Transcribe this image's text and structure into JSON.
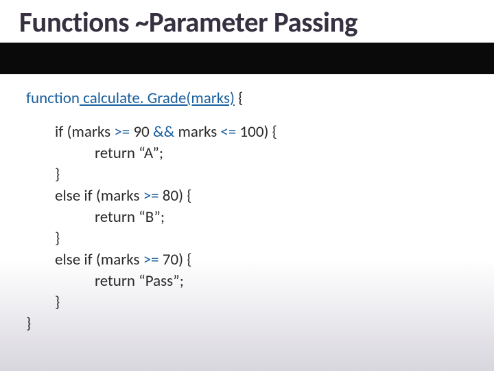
{
  "title": "Functions ~Parameter Passing",
  "code": {
    "line1_kw": "function",
    "line1_fn": " calculate. Grade(marks)",
    "line1_brace": " {",
    "line2_pre": "if (marks ",
    "line2_op1": ">=",
    "line2_mid": " 90 ",
    "line2_amp": "&&",
    "line2_mid2": "  marks ",
    "line2_op2": "<=",
    "line2_end": " 100) {",
    "line3": "return “A”;",
    "line4": "}",
    "line5_pre": "else if (marks ",
    "line5_op": ">=",
    "line5_end": " 80) {",
    "line6": "return “B”;",
    "line7": "}",
    "line8_pre": " else if (marks ",
    "line8_op": ">=",
    "line8_end": " 70) {",
    "line9": "return “Pass”;",
    "line10": "}",
    "line11": "}"
  }
}
